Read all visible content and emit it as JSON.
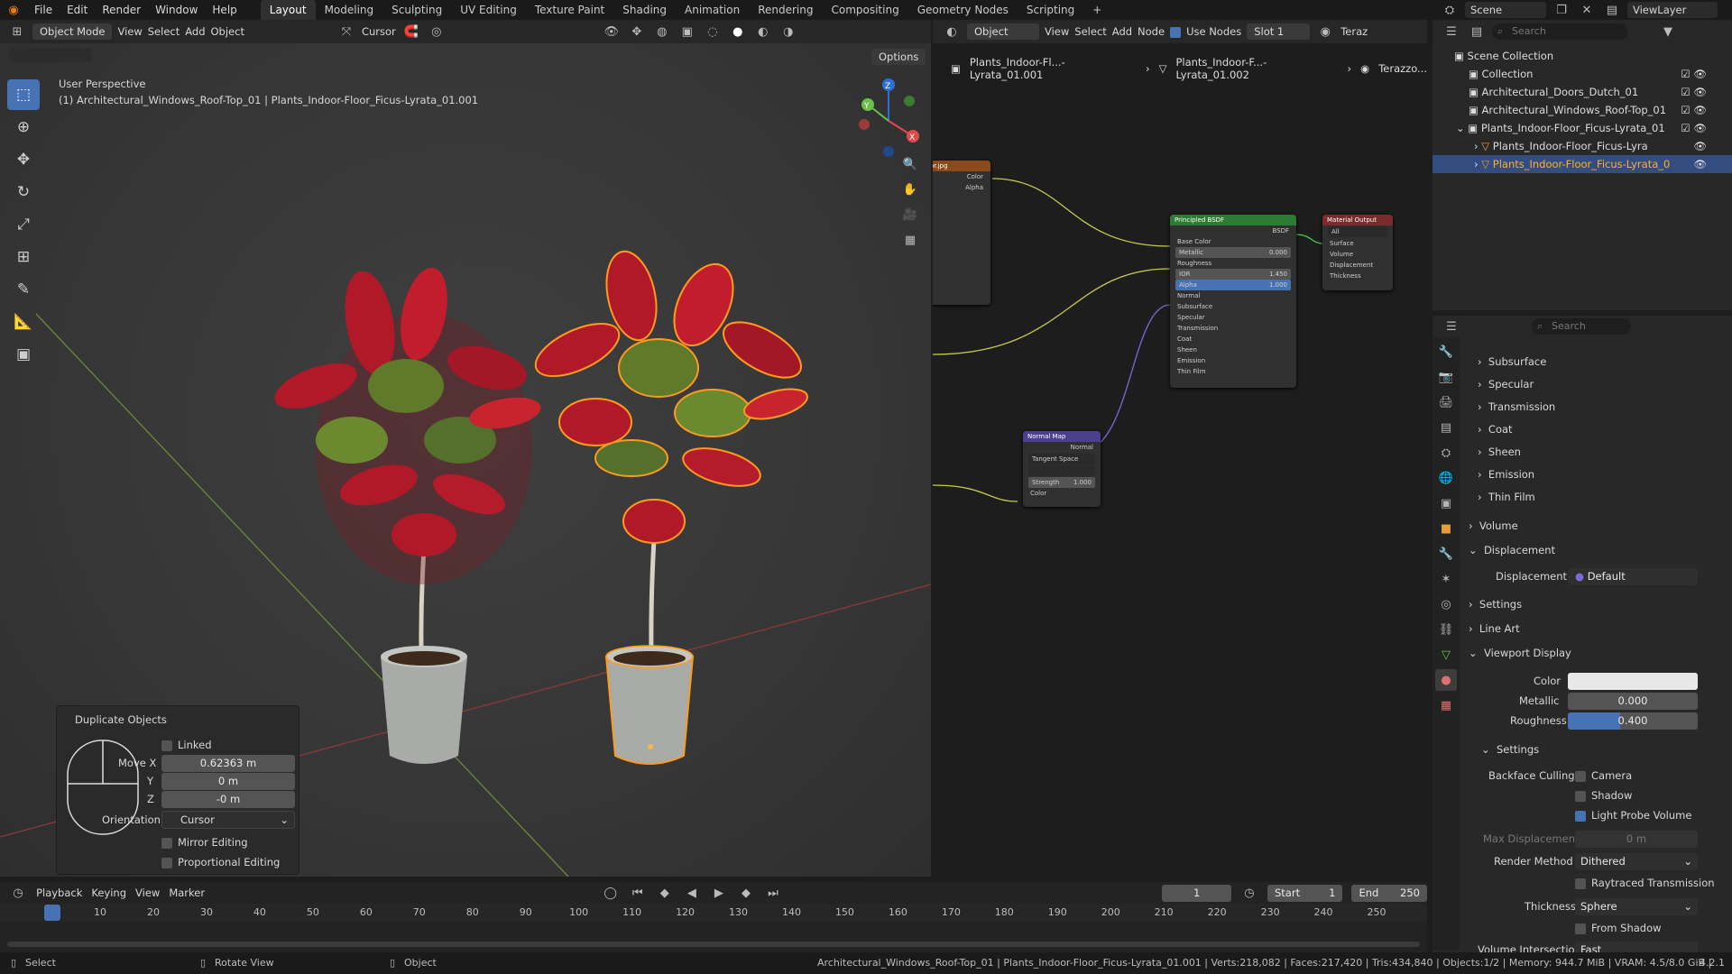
{
  "topbar": {
    "menus": [
      "File",
      "Edit",
      "Render",
      "Window",
      "Help"
    ],
    "workspaces": [
      "Layout",
      "Modeling",
      "Sculpting",
      "UV Editing",
      "Texture Paint",
      "Shading",
      "Animation",
      "Rendering",
      "Compositing",
      "Geometry Nodes",
      "Scripting"
    ],
    "active_workspace": "Layout",
    "add_tab": "+",
    "scene": "Scene",
    "view_layer": "ViewLayer"
  },
  "viewport_header": {
    "mode": "Object Mode",
    "menus": [
      "View",
      "Select",
      "Add",
      "Object"
    ],
    "pivot": "Cursor",
    "options": "Options"
  },
  "viewport": {
    "perspective": "User Perspective",
    "selection_info": "(1) Architectural_Windows_Roof-Top_01 | Plants_Indoor-Floor_Ficus-Lyrata_01.001",
    "gizmo": {
      "z": "Z",
      "y": "Y",
      "x": "X"
    }
  },
  "duplicate_panel": {
    "title": "Duplicate Objects",
    "linked": "Linked",
    "move_x_label": "Move X",
    "move_x": "0.62363 m",
    "y_label": "Y",
    "y": "0 m",
    "z_label": "Z",
    "z": "-0 m",
    "orientation_label": "Orientation",
    "orientation": "Cursor",
    "mirror": "Mirror Editing",
    "proportional": "Proportional Editing"
  },
  "node_header": {
    "type": "Object",
    "menus": [
      "View",
      "Select",
      "Add",
      "Node"
    ],
    "use_nodes": "Use Nodes",
    "slot": "Slot 1",
    "material": "Teraz"
  },
  "breadcrumb": [
    "Plants_Indoor-Fl...-Lyrata_01.001",
    "Plants_Indoor-F...-Lyrata_01.002",
    "Terazzo..."
  ],
  "nodes": {
    "image": {
      "title": "lor.jpg",
      "outputs": [
        "Color",
        "Alpha"
      ]
    },
    "bsdf": {
      "title": "Principled BSDF",
      "output": "BSDF",
      "rows": [
        "Base Color",
        "Metallic",
        "Roughness",
        "IOR",
        "Alpha",
        "Normal",
        "Subsurface",
        "Specular",
        "Transmission",
        "Coat",
        "Sheen",
        "Emission",
        "Thin Film"
      ],
      "metallic": "0.000",
      "ior": "1.450",
      "alpha": "1.000"
    },
    "output": {
      "title": "Material Output",
      "target": "All",
      "rows": [
        "Surface",
        "Volume",
        "Displacement",
        "Thickness"
      ]
    },
    "normal_map": {
      "title": "Normal Map",
      "output": "Normal",
      "space": "Tangent Space",
      "strength_label": "Strength",
      "strength": "1.000",
      "input": "Color"
    }
  },
  "outliner": {
    "search_placeholder": "Search",
    "items": [
      {
        "label": "Scene Collection"
      },
      {
        "label": "Collection"
      },
      {
        "label": "Architectural_Doors_Dutch_01"
      },
      {
        "label": "Architectural_Windows_Roof-Top_01"
      },
      {
        "label": "Plants_Indoor-Floor_Ficus-Lyrata_01"
      },
      {
        "label": "Plants_Indoor-Floor_Ficus-Lyra"
      },
      {
        "label": "Plants_Indoor-Floor_Ficus-Lyrata_0"
      }
    ]
  },
  "properties": {
    "search_placeholder": "Search",
    "collapsed": [
      "Subsurface",
      "Specular",
      "Transmission",
      "Coat",
      "Sheen",
      "Emission",
      "Thin Film"
    ],
    "volume": "Volume",
    "displacement_section": "Displacement",
    "displacement_label": "Displacement",
    "displacement_value": "Default",
    "settings": "Settings",
    "line_art": "Line Art",
    "viewport_display": "Viewport Display",
    "color_label": "Color",
    "metallic_label": "Metallic",
    "metallic": "0.000",
    "roughness_label": "Roughness",
    "roughness": "0.400",
    "roughness_fraction": 0.4,
    "settings2": "Settings",
    "backface_label": "Backface Culling",
    "camera": "Camera",
    "shadow": "Shadow",
    "light_probe": "Light Probe Volume",
    "max_disp_label": "Max Displacement",
    "max_disp": "0 m",
    "render_method_label": "Render Method",
    "render_method": "Dithered",
    "raytraced": "Raytraced Transmission",
    "thickness_label": "Thickness",
    "thickness": "Sphere",
    "from_shadow": "From Shadow",
    "vol_intersection_label": "Volume Intersection",
    "vol_intersection": "Fast"
  },
  "timeline": {
    "menus": [
      "Playback",
      "Keying",
      "View",
      "Marker"
    ],
    "current_frame": "1",
    "start_label": "Start",
    "start": "1",
    "end_label": "End",
    "end": "250",
    "ticks": [
      "1",
      "10",
      "20",
      "30",
      "40",
      "50",
      "60",
      "70",
      "80",
      "90",
      "100",
      "110",
      "120",
      "130",
      "140",
      "150",
      "160",
      "170",
      "180",
      "190",
      "200",
      "210",
      "220",
      "230",
      "240",
      "250"
    ]
  },
  "status": {
    "select": "Select",
    "rotate": "Rotate View",
    "object": "Object",
    "info": "Architectural_Windows_Roof-Top_01 | Plants_Indoor-Floor_Ficus-Lyrata_01.001 | Verts:218,082 | Faces:217,420 | Tris:434,840 | Objects:1/2 | Memory: 944.7 MiB | VRAM: 4.5/8.0 GiB |",
    "version": "4.2.1"
  },
  "colors": {
    "accent": "#4772b3",
    "selection_outline": "#ff9a1f",
    "leaf_red": "#b01a28",
    "leaf_green": "#5e7a2a",
    "bsdf_header": "#2c7c33",
    "output_header": "#7a2b2b",
    "normalmap_header": "#4b3f8f"
  }
}
